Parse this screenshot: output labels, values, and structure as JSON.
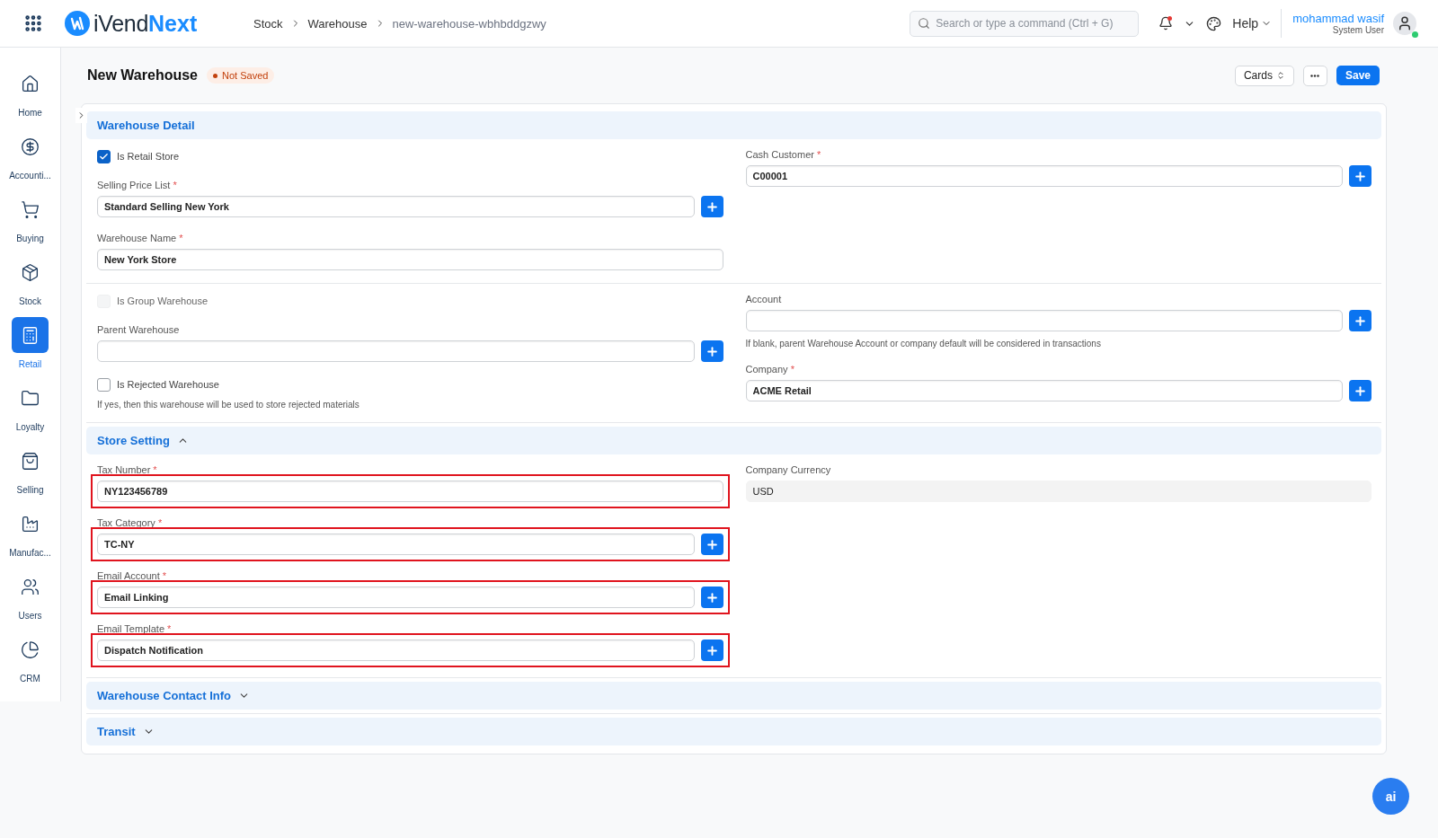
{
  "topbar": {
    "logo": {
      "prefix": "iVend",
      "suffix": "Next"
    },
    "breadcrumbs": [
      "Stock",
      "Warehouse",
      "new-warehouse-wbhbddgzwy"
    ],
    "search": {
      "placeholder": "Search or type a command (Ctrl + G)"
    },
    "help": "Help",
    "user": {
      "name": "mohammad wasif",
      "role": "System User"
    }
  },
  "sidebar": {
    "items": [
      {
        "label": "Home",
        "selected": false
      },
      {
        "label": "Accounti...",
        "selected": false
      },
      {
        "label": "Buying",
        "selected": false
      },
      {
        "label": "Stock",
        "selected": false
      },
      {
        "label": "Retail",
        "selected": true
      },
      {
        "label": "Loyalty",
        "selected": false
      },
      {
        "label": "Selling",
        "selected": false
      },
      {
        "label": "Manufac...",
        "selected": false
      },
      {
        "label": "Users",
        "selected": false
      },
      {
        "label": "CRM",
        "selected": false
      }
    ]
  },
  "header": {
    "title": "New Warehouse",
    "status": "Not Saved",
    "view": "Cards",
    "save": "Save"
  },
  "sections": [
    {
      "title": "Warehouse Detail",
      "groups": [
        {
          "left": [
            {
              "kind": "checkbox",
              "label": "Is Retail Store",
              "checked": true,
              "disabled": false
            },
            {
              "kind": "link",
              "label": "Selling Price List",
              "marker": "*",
              "value": "Standard Selling New York"
            },
            {
              "kind": "data",
              "label": "Warehouse Name",
              "marker": "*",
              "value": "New York Store"
            }
          ],
          "right": [
            {
              "kind": "link",
              "label": "Cash Customer",
              "marker": "*",
              "value": "C00001"
            }
          ]
        },
        {
          "left": [
            {
              "kind": "checkbox",
              "label": "Is Group Warehouse",
              "checked": false,
              "disabled": true
            },
            {
              "kind": "link",
              "label": "Parent Warehouse"
            },
            {
              "kind": "checkbox",
              "label": "Is Rejected Warehouse",
              "checked": false,
              "disabled": false,
              "description": "If yes, then this warehouse will be used to store rejected materials"
            }
          ],
          "right": [
            {
              "kind": "link",
              "label": "Account",
              "description": "If blank, parent Warehouse Account or company default will be considered in transactions"
            },
            {
              "kind": "link",
              "label": "Company",
              "marker": "*",
              "value": "ACME Retail"
            }
          ]
        }
      ]
    },
    {
      "title": "Store Setting",
      "expanded": true,
      "groups": [
        {
          "left": [
            {
              "kind": "data",
              "label": "Tax Number",
              "marker": "*",
              "value": "NY123456789",
              "flagged": true
            },
            {
              "kind": "link",
              "label": "Tax Category",
              "marker": "*",
              "value": "TC-NY",
              "flagged": true
            },
            {
              "kind": "link",
              "label": "Email Account",
              "marker": "*",
              "value": "Email Linking",
              "flagged": true
            },
            {
              "kind": "link",
              "label": "Email Template",
              "marker": "*",
              "value": "Dispatch Notification",
              "flagged": true
            }
          ],
          "right": [
            {
              "kind": "readonly",
              "label": "Company Currency",
              "value": "USD",
              "flagged": false
            }
          ]
        }
      ]
    },
    {
      "title": "Warehouse Contact Info",
      "expanded": false
    },
    {
      "title": "Transit",
      "expanded": false
    }
  ],
  "assistant": {
    "label": "ai"
  }
}
